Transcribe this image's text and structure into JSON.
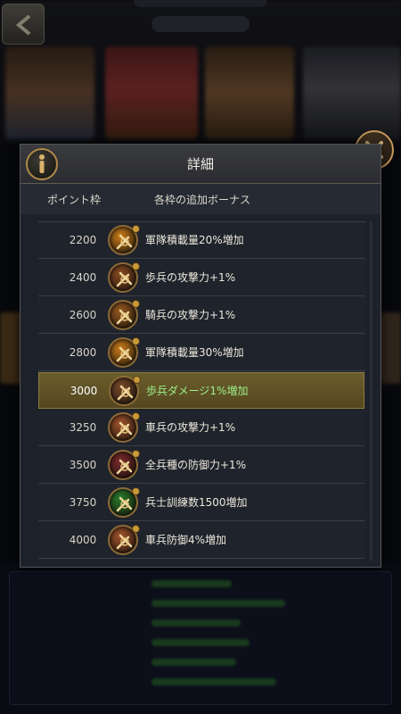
{
  "dialog": {
    "title": "詳細",
    "col_point": "ポイント枠",
    "col_bonus": "各枠の追加ボーナス",
    "info_icon": "info-icon",
    "close_icon": "close-icon"
  },
  "rows": [
    {
      "point": "2200",
      "bonus": "軍隊積載量20%増加",
      "icon": "cargo-icon",
      "icon_color": "#c97a1a",
      "highlighted": false
    },
    {
      "point": "2400",
      "bonus": "歩兵の攻撃力+1%",
      "icon": "infantry-attack-icon",
      "icon_color": "#8a4a22",
      "highlighted": false
    },
    {
      "point": "2600",
      "bonus": "騎兵の攻撃力+1%",
      "icon": "cavalry-attack-icon",
      "icon_color": "#9a5a20",
      "highlighted": false
    },
    {
      "point": "2800",
      "bonus": "軍隊積載量30%増加",
      "icon": "cargo-icon",
      "icon_color": "#c97a1a",
      "highlighted": false
    },
    {
      "point": "3000",
      "bonus": "歩兵ダメージ1%増加",
      "icon": "infantry-damage-icon",
      "icon_color": "#7a4a2a",
      "highlighted": true
    },
    {
      "point": "3250",
      "bonus": "車兵の攻撃力+1%",
      "icon": "chariot-attack-icon",
      "icon_color": "#a0522a",
      "highlighted": false
    },
    {
      "point": "3500",
      "bonus": "全兵種の防御力+1%",
      "icon": "shield-defense-icon",
      "icon_color": "#7a2a2a",
      "highlighted": false
    },
    {
      "point": "3750",
      "bonus": "兵士訓練数1500増加",
      "icon": "training-icon",
      "icon_color": "#2a7a2a",
      "highlighted": false
    },
    {
      "point": "4000",
      "bonus": "車兵防御4%増加",
      "icon": "chariot-defense-icon",
      "icon_color": "#a0522a",
      "highlighted": false
    }
  ],
  "colors": {
    "highlight": "#6a5d2d",
    "highlight_text": "#9df08a",
    "frame_gold": "#c79a5a"
  },
  "background": {
    "back_icon": "back-arrow-icon"
  }
}
